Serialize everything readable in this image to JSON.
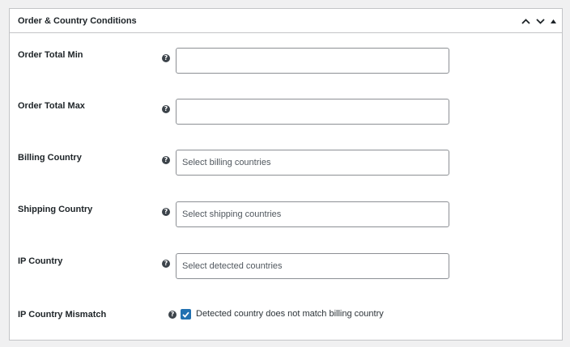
{
  "panel": {
    "title": "Order & Country Conditions",
    "actions": {
      "move_up_icon": "chevron-up-icon",
      "move_down_icon": "chevron-down-icon",
      "toggle_icon": "triangle-up-icon"
    }
  },
  "fields": {
    "order_total_min": {
      "label": "Order Total Min",
      "value": "",
      "placeholder": ""
    },
    "order_total_max": {
      "label": "Order Total Max",
      "value": "",
      "placeholder": ""
    },
    "billing_country": {
      "label": "Billing Country",
      "placeholder": "Select billing countries"
    },
    "shipping_country": {
      "label": "Shipping Country",
      "placeholder": "Select shipping countries"
    },
    "ip_country": {
      "label": "IP Country",
      "placeholder": "Select detected countries"
    },
    "ip_country_mismatch": {
      "label": "IP Country Mismatch",
      "checkbox_label": "Detected country does not match billing country",
      "checked": true
    }
  },
  "colors": {
    "accent": "#2271b1",
    "border": "#c3c4c7",
    "help_icon": "#3c434a"
  }
}
